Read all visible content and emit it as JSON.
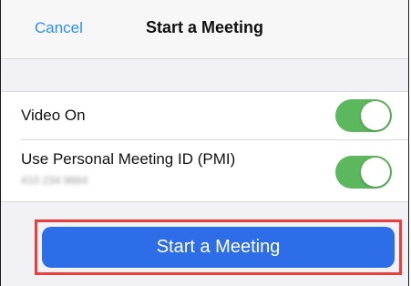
{
  "header": {
    "cancel_label": "Cancel",
    "title": "Start a Meeting"
  },
  "settings": {
    "video_on": {
      "label": "Video On",
      "enabled": true
    },
    "pmi": {
      "label": "Use Personal Meeting ID (PMI)",
      "value": "410 234 9664",
      "enabled": true
    }
  },
  "actions": {
    "start_label": "Start a Meeting"
  },
  "colors": {
    "accent": "#2d8cff",
    "button": "#2d6ee8",
    "toggle_on": "#5cb85c",
    "highlight": "#e8403f"
  }
}
